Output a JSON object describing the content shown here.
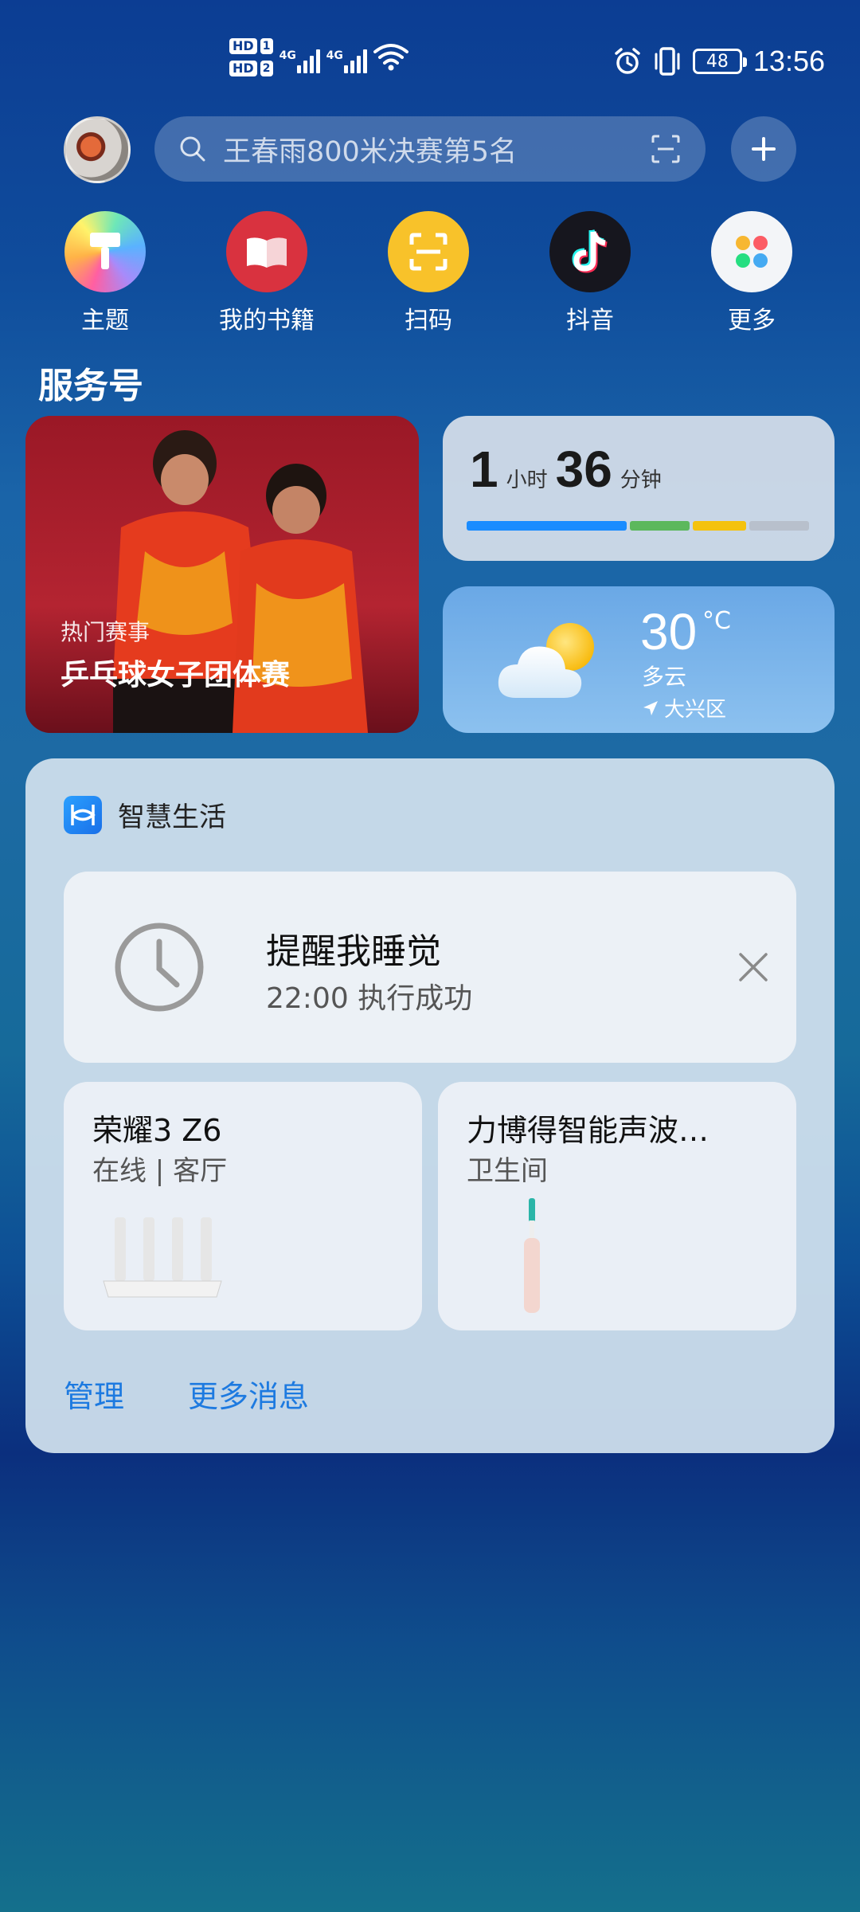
{
  "status_bar": {
    "sim1": "HD",
    "sim1_num": "1",
    "sim2": "HD",
    "sim2_num": "2",
    "net1": "4G",
    "net2": "4G",
    "battery": "48",
    "time": "13:56"
  },
  "search": {
    "placeholder": "王春雨800米决赛第5名"
  },
  "apps": [
    {
      "label": "主题",
      "icon": "theme-brush-icon"
    },
    {
      "label": "我的书籍",
      "icon": "book-icon"
    },
    {
      "label": "扫码",
      "icon": "scan-icon"
    },
    {
      "label": "抖音",
      "icon": "douyin-icon"
    },
    {
      "label": "更多",
      "icon": "more-apps-icon"
    }
  ],
  "section": {
    "title": "服务号"
  },
  "news": {
    "tag": "热门赛事",
    "title": "乒乓球女子团体赛"
  },
  "usage": {
    "hours": "1",
    "hours_unit": "小时",
    "minutes": "36",
    "minutes_unit": "分钟",
    "segments": [
      {
        "color": "#1a8cff",
        "share": 0.48
      },
      {
        "color": "#5cb85c",
        "share": 0.18
      },
      {
        "color": "#f4c20d",
        "share": 0.16
      },
      {
        "color": "#b8c0cc",
        "share": 0.18
      }
    ]
  },
  "weather": {
    "temp": "30",
    "unit": "°C",
    "condition": "多云",
    "location": "大兴区"
  },
  "smart_life": {
    "title": "智慧生活",
    "reminder": {
      "title": "提醒我睡觉",
      "subtitle": "22:00 执行成功"
    },
    "devices": [
      {
        "name": "荣耀3 Z6",
        "status": "在线 | 客厅"
      },
      {
        "name": "力博得智能声波…",
        "status": "卫生间"
      }
    ],
    "manage_label": "管理",
    "more_label": "更多消息"
  }
}
